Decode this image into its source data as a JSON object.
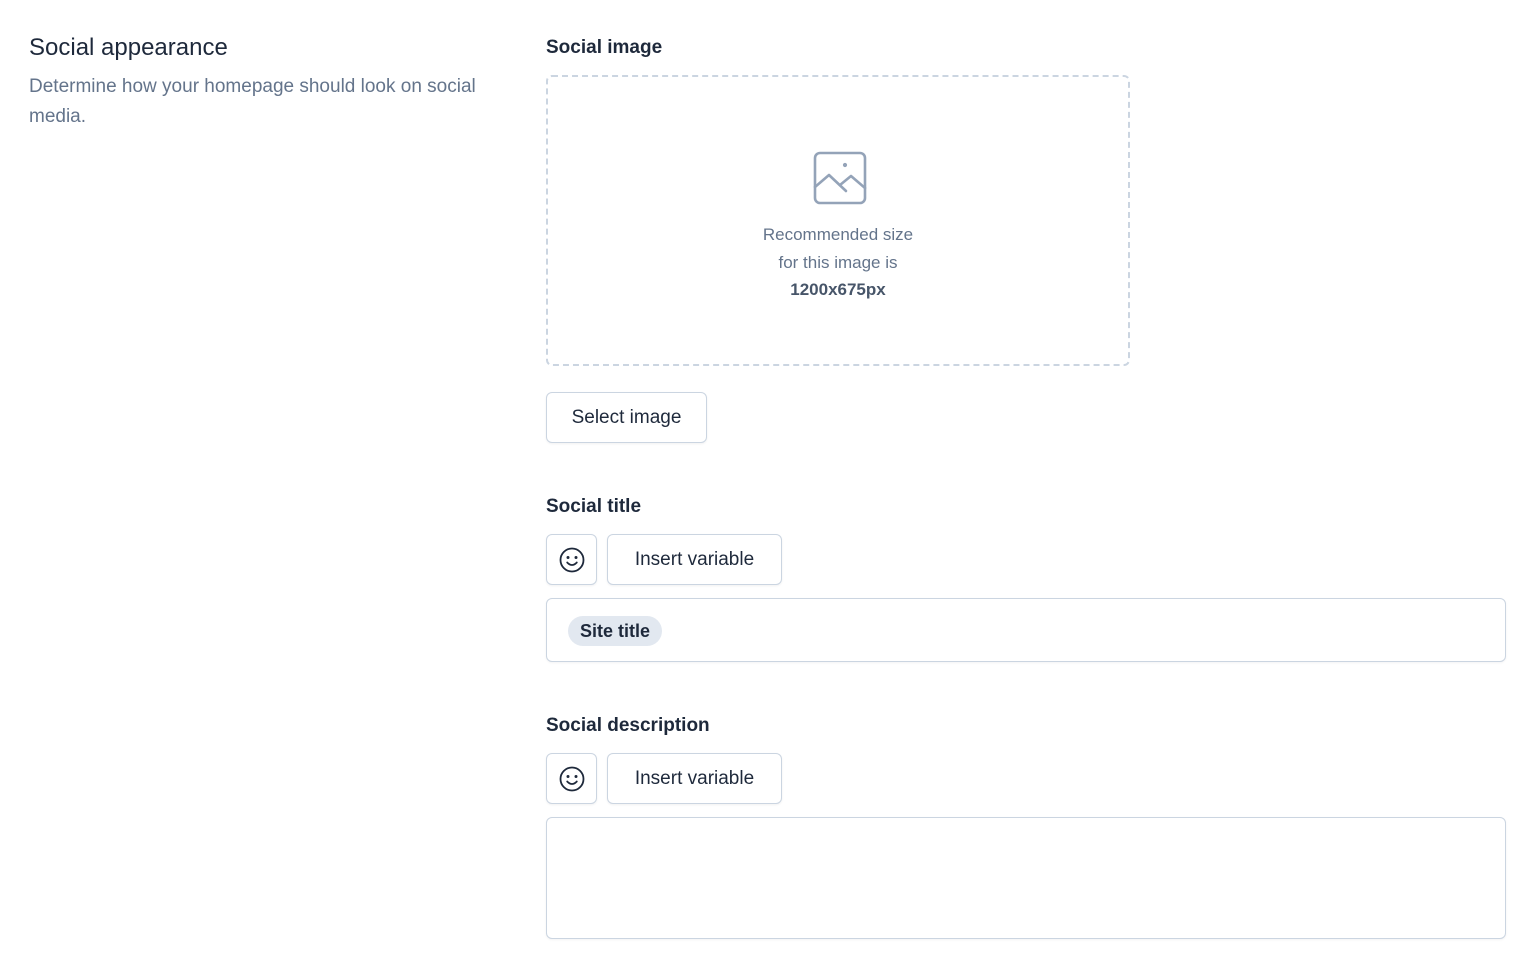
{
  "section": {
    "title": "Social appearance",
    "description": "Determine how your homepage should look on social media."
  },
  "social_image": {
    "label": "Social image",
    "icon": "image-placeholder-icon",
    "hint_line1": "Recommended size",
    "hint_line2": "for this image is",
    "hint_size": "1200x675px",
    "select_button": "Select image"
  },
  "social_title": {
    "label": "Social title",
    "emoji_icon": "smiley-icon",
    "insert_variable_button": "Insert variable",
    "tags": [
      "Site title"
    ]
  },
  "social_description": {
    "label": "Social description",
    "emoji_icon": "smiley-icon",
    "insert_variable_button": "Insert variable",
    "value": ""
  },
  "colors": {
    "text_primary": "#1e293b",
    "text_muted": "#64748b",
    "border": "#cbd5e1",
    "tag_background": "#e2e8f0"
  }
}
